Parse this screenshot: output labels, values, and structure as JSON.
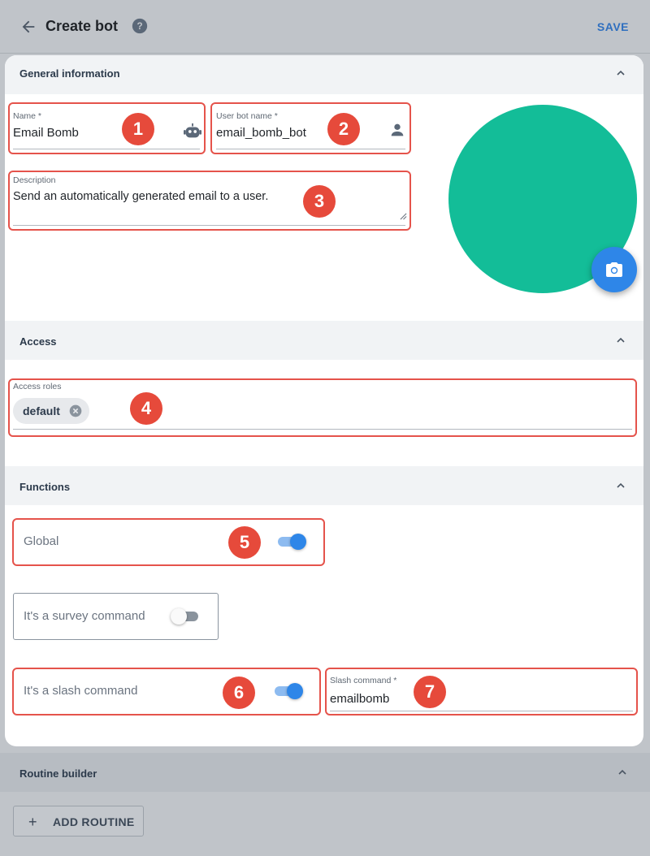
{
  "header": {
    "title": "Create bot",
    "save_label": "SAVE",
    "back_icon": "arrow-left-icon",
    "help_icon": "help-circle-icon"
  },
  "general": {
    "section_label": "General information",
    "name": {
      "label": "Name *",
      "value": "Email Bomb",
      "icon": "robot-icon"
    },
    "user_bot_name": {
      "label": "User bot name *",
      "value": "email_bomb_bot",
      "icon": "person-icon"
    },
    "description": {
      "label": "Description",
      "value": "Send an automatically generated email to a user."
    },
    "avatar_color": "#13bd98",
    "camera_icon": "camera-icon"
  },
  "access": {
    "section_label": "Access",
    "roles_label": "Access roles",
    "roles": [
      "default"
    ]
  },
  "functions": {
    "section_label": "Functions",
    "global": {
      "label": "Global",
      "on": true
    },
    "survey": {
      "label": "It's a survey command",
      "on": false
    },
    "slash": {
      "label": "It's a slash command",
      "on": true
    },
    "slash_command": {
      "label": "Slash command *",
      "value": "emailbomb"
    }
  },
  "routine": {
    "section_label": "Routine builder",
    "add_label": "ADD ROUTINE"
  },
  "annotations": [
    "1",
    "2",
    "3",
    "4",
    "5",
    "6",
    "7"
  ],
  "colors": {
    "accent": "#2e86e8",
    "annotation": "#e64a3b",
    "save": "#2f6fbf"
  }
}
